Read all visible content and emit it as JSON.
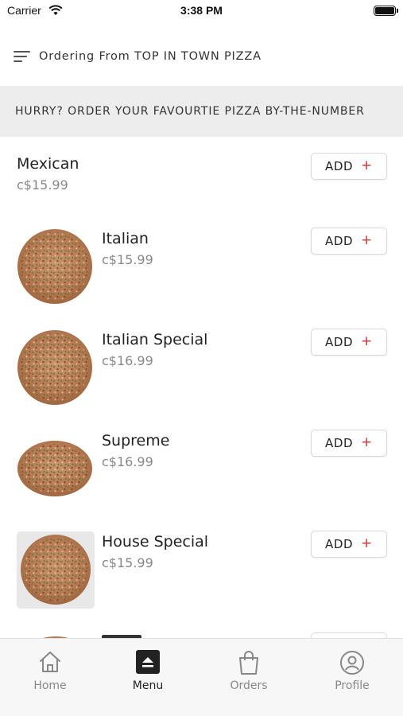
{
  "status_bar": {
    "carrier": "Carrier",
    "time": "3:38 PM"
  },
  "header": {
    "title": "Ordering From TOP IN TOWN PIZZA",
    "menu_icon": "menu-lines-icon"
  },
  "banner": {
    "text": "HURRY? ORDER YOUR FAVOURTIE PIZZA BY-THE-NUMBER"
  },
  "items": [
    {
      "name": "Mexican",
      "price": "c$15.99",
      "add_label": "ADD",
      "add_symbol": "+"
    },
    {
      "name": "Italian",
      "price": "c$15.99",
      "add_label": "ADD",
      "add_symbol": "+"
    },
    {
      "name": "Italian Special",
      "price": "c$16.99",
      "add_label": "ADD",
      "add_symbol": "+"
    },
    {
      "name": "Supreme",
      "price": "c$16.99",
      "add_label": "ADD",
      "add_symbol": "+"
    },
    {
      "name": "House Special",
      "price": "c$15.99",
      "add_label": "ADD",
      "add_symbol": "+"
    }
  ],
  "tabs": [
    {
      "label": "Home",
      "icon": "home-icon",
      "active": false
    },
    {
      "label": "Menu",
      "icon": "menu-icon",
      "active": true
    },
    {
      "label": "Orders",
      "icon": "shopping-bag-icon",
      "active": false
    },
    {
      "label": "Profile",
      "icon": "user-icon",
      "active": false
    }
  ],
  "colors": {
    "accent_plus": "#d0302a",
    "banner_bg": "#ededed",
    "tabbar_bg": "#f7f7f7",
    "active_tab": "#222222",
    "inactive_tab": "#888888"
  }
}
